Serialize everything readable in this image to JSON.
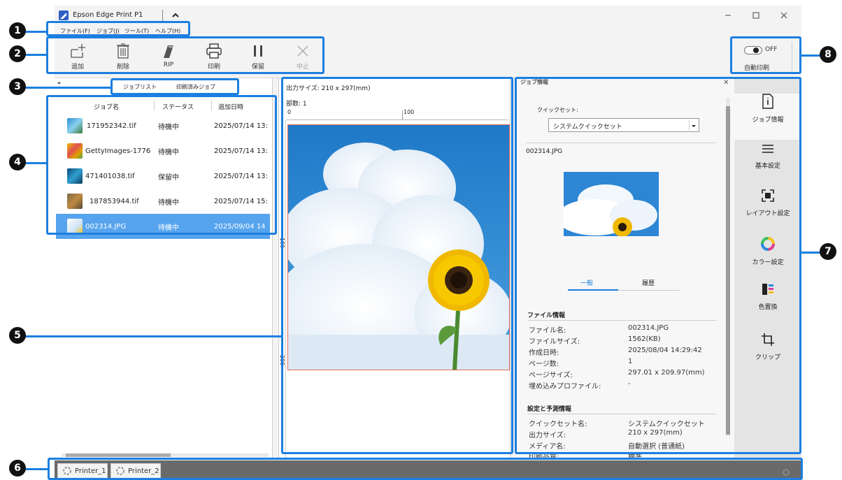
{
  "app": {
    "title": "Epson Edge Print P1"
  },
  "menu": [
    "ファイル(F)",
    "ジョブ(J)",
    "ツール(T)",
    "ヘルプ(H)"
  ],
  "toolbar": {
    "add": "追加",
    "delete": "削除",
    "rip": "RIP",
    "print": "印刷",
    "hold": "保留",
    "cancel": "中止",
    "auto_print_label": "自動印刷",
    "auto_print_state": "OFF"
  },
  "job_tabs": [
    "ジョブリスト",
    "印刷済みジョブ"
  ],
  "job_table": {
    "headers": [
      "ジョブ名",
      "ステータス",
      "追加日時"
    ],
    "rows": [
      {
        "name": "171952342.tif",
        "status": "待機中",
        "date": "2025/07/14 13:"
      },
      {
        "name": "GettyImages-1776",
        "status": "待機中",
        "date": "2025/07/14 13:"
      },
      {
        "name": "471401038.tif",
        "status": "保留中",
        "date": "2025/07/14 13:"
      },
      {
        "name": "187853944.tif",
        "status": "待機中",
        "date": "2025/07/14 15:"
      },
      {
        "name": "002314.JPG",
        "status": "待機中",
        "date": "2025/09/04 14"
      }
    ]
  },
  "preview": {
    "output_size": "出力サイズ:  210 x 297(mm)",
    "copies": "部数:  1",
    "ruler_0": "0",
    "ruler_100": "100",
    "vruler_100": "100",
    "vruler_200": "200"
  },
  "job_info": {
    "header": "ジョブ情報",
    "quickset_label": "クイックセット:",
    "quickset_value": "システムクイックセット",
    "file_title": "002314.JPG",
    "tabs": [
      "一般",
      "履歴"
    ],
    "file_section": "ファイル情報",
    "file_rows": [
      {
        "k": "ファイル名:",
        "v": "002314.JPG"
      },
      {
        "k": "ファイルサイズ:",
        "v": "1562(KB)"
      },
      {
        "k": "作成日時:",
        "v": "2025/08/04 14:29:42"
      },
      {
        "k": "ページ数:",
        "v": "1"
      },
      {
        "k": "ページサイズ:",
        "v": "297.01 x 209.97(mm)"
      },
      {
        "k": "埋め込みプロファイル:",
        "v": "-"
      }
    ],
    "settings_section": "設定と予測情報",
    "settings_rows": [
      {
        "k": "クイックセット名:",
        "v": "システムクイックセット"
      },
      {
        "k": "出力サイズ:",
        "v": "210 x 297(mm)"
      },
      {
        "k": "メディア名:",
        "v": "自動選択 (普通紙)"
      },
      {
        "k": "印刷品質:",
        "v": "標準"
      }
    ]
  },
  "side_nav": [
    "ジョブ情報",
    "基本設定",
    "レイアウト設定",
    "カラー設定",
    "色置換",
    "クリップ"
  ],
  "printers": [
    "Printer_1",
    "Printer_2"
  ],
  "callouts": [
    "1",
    "2",
    "3",
    "4",
    "5",
    "6",
    "7",
    "8"
  ],
  "colors": {
    "accent": "#1c7fe0",
    "selection": "#56a4ee",
    "status_bar": "#6a6a6a"
  }
}
